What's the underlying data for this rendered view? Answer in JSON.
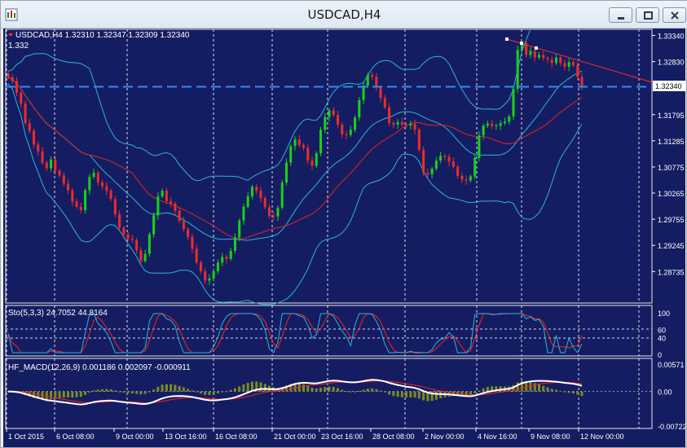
{
  "window": {
    "title": "USDCAD,H4"
  },
  "price_panel": {
    "header": "USDCAD,H4  1.32310 1.32347 1.32309 1.32340",
    "top_value": "1.332",
    "current_price": "1.32340",
    "price_ticks": [
      "1.33340",
      "1.32830",
      "1.32340",
      "1.31795",
      "1.31285",
      "1.30775",
      "1.30265",
      "1.29755",
      "1.29245",
      "1.28735"
    ]
  },
  "stoch_panel": {
    "header": "Sto(5,3,3) 24.7052 44.8164",
    "ticks": [
      "100",
      "60",
      "40",
      "0"
    ]
  },
  "macd_panel": {
    "header": "HF_MACD(12,26,9) 0.001186 0.002097 -0.000911",
    "ticks": [
      "0.00571",
      "0.00",
      "-0.00722"
    ]
  },
  "time_axis": [
    "1 Oct 2015",
    "6 Oct 08:00",
    "9 Oct 00:00",
    "13 Oct 16:00",
    "16 Oct 08:00",
    "21 Oct 00:00",
    "23 Oct 16:00",
    "28 Oct 08:00",
    "2 Nov 00:00",
    "4 Nov 16:00",
    "9 Nov 08:00",
    "12 Nov 00:00"
  ],
  "colors": {
    "background": "#151d62",
    "bull_candle": "#16d316",
    "bear_candle": "#ef2b2b",
    "bollinger": "#2bb5d6",
    "moving_average": "#e2231f",
    "grid": "#ffffff",
    "bid_line": "#2d8cff",
    "trendline": "#ff2a2a",
    "macd_line": "#ffffff",
    "signal_line": "#ff2020",
    "histogram": "#7c8c1c"
  },
  "chart_data": {
    "type": "candlestick",
    "series": [
      {
        "name": "USDCAD,H4",
        "points": [
          1.3252,
          1.3245,
          1.3222,
          1.3201,
          1.3163,
          1.3148,
          1.3121,
          1.3108,
          1.3086,
          1.3075,
          1.3092,
          1.307,
          1.3061,
          1.3045,
          1.3032,
          1.301,
          1.3,
          1.2993,
          1.3032,
          1.3058,
          1.3066,
          1.3047,
          1.304,
          1.3031,
          1.3015,
          1.2985,
          1.2959,
          1.2946,
          1.2937,
          1.2935,
          1.2915,
          1.2894,
          1.2908,
          1.2946,
          1.2983,
          1.302,
          1.3031,
          1.3011,
          1.3006,
          1.2992,
          1.2972,
          1.2956,
          1.2941,
          1.2918,
          1.2891,
          1.2874,
          1.2856,
          1.286,
          1.2874,
          1.2891,
          1.2902,
          1.2898,
          1.2914,
          1.294,
          1.2973,
          1.3,
          1.302,
          1.3039,
          1.3031,
          1.3017,
          1.2999,
          1.2982,
          1.2981,
          1.2998,
          1.3047,
          1.3086,
          1.3118,
          1.3131,
          1.312,
          1.3115,
          1.309,
          1.308,
          1.3104,
          1.315,
          1.3175,
          1.3188,
          1.3179,
          1.316,
          1.3141,
          1.314,
          1.315,
          1.3174,
          1.3208,
          1.3236,
          1.3257,
          1.3253,
          1.3233,
          1.3212,
          1.3194,
          1.3163,
          1.316,
          1.3165,
          1.316,
          1.3158,
          1.3162,
          1.315,
          1.3111,
          1.3066,
          1.3063,
          1.3074,
          1.309,
          1.3099,
          1.3097,
          1.3088,
          1.3078,
          1.306,
          1.3053,
          1.3051,
          1.3059,
          1.3095,
          1.3139,
          1.3158,
          1.3162,
          1.3157,
          1.3158,
          1.3163,
          1.3166,
          1.3176,
          1.323,
          1.3306,
          1.3319,
          1.3296,
          1.3304,
          1.3291,
          1.3296,
          1.329,
          1.3287,
          1.328,
          1.3291,
          1.328,
          1.3273,
          1.3282,
          1.3276,
          1.3253,
          1.3234
        ]
      },
      {
        "name": "Bollinger upper"
      },
      {
        "name": "Bollinger lower"
      },
      {
        "name": "Moving average"
      }
    ],
    "ylim": [
      1.282,
      1.3338
    ],
    "stochastic": {
      "main": 24.7052,
      "signal": 44.8164,
      "levels": [
        60,
        40
      ],
      "ylim": [
        0,
        100
      ]
    },
    "macd": {
      "macd": 0.001186,
      "signal": 0.002097,
      "histogram": -0.000911,
      "ylim": [
        -0.00722,
        0.00571
      ]
    }
  }
}
